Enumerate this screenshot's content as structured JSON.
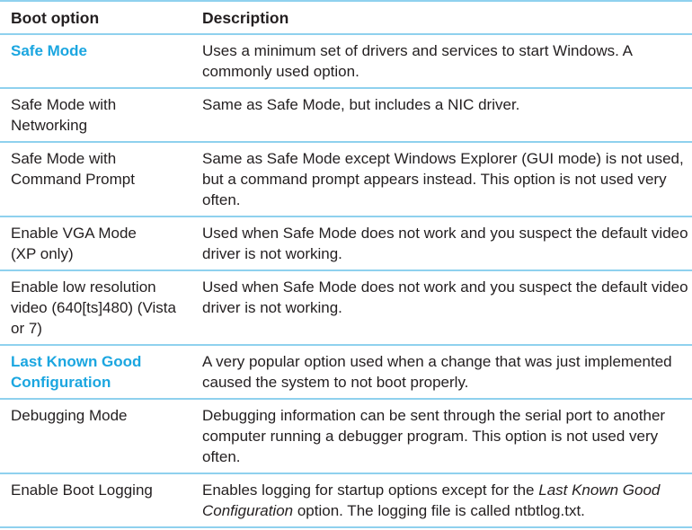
{
  "header": {
    "col1": "Boot option",
    "col2": "Description"
  },
  "rows": [
    {
      "option": "Safe Mode",
      "description": "Uses a minimum set of drivers and services to start Windows. A commonly used option."
    },
    {
      "option": "Safe Mode with Networking",
      "description": "Same as Safe Mode, but includes a NIC driver."
    },
    {
      "option": "Safe Mode with Command Prompt",
      "description": "Same as Safe Mode except Windows Explorer (GUI mode) is not used, but a command prompt appears instead. This option is not used very often."
    },
    {
      "option": "Enable VGA Mode (XP only)",
      "description": "Used when Safe Mode does not work and you suspect the default video driver is not working."
    },
    {
      "option": "Enable low resolution video (640[ts]480) (Vista or 7)",
      "description": "Used when Safe Mode does not work and you suspect the default video driver is not working."
    },
    {
      "option": "Last Known Good Configuration",
      "description": "A very popular option used when a change that was just implemented caused the system to not boot properly."
    },
    {
      "option": "Debugging Mode",
      "description": "Debugging information can be sent through the serial port to another computer running a debugger program. This option is not used very often."
    },
    {
      "option": "Enable Boot Logging",
      "description_parts": [
        "Enables logging for startup options except for the ",
        "Last Known Good Configuration",
        " option. The logging file is called ntbtlog.txt."
      ]
    }
  ],
  "colors": {
    "rule": "#8fd1ee",
    "highlight": "#1ba6e0",
    "text": "#231f20"
  }
}
